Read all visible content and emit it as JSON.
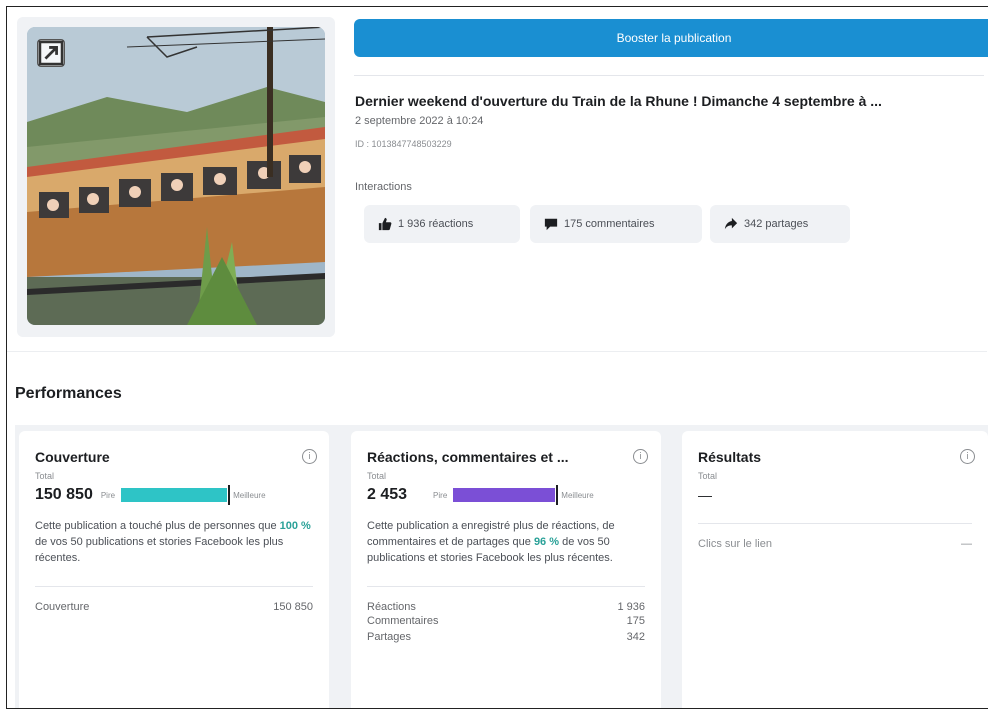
{
  "post": {
    "boost_label": "Booster la publication",
    "title": "Dernier weekend d'ouverture du Train de la Rhune ! Dimanche 4 septembre à ...",
    "date": "2 septembre 2022 à 10:24",
    "id_text": "ID : 1013847748503229",
    "interactions_label": "Interactions",
    "chips": [
      {
        "icon": "thumbs-up-icon",
        "label": "1 936 réactions"
      },
      {
        "icon": "comment-icon",
        "label": "175 commentaires"
      },
      {
        "icon": "share-icon",
        "label": "342 partages"
      }
    ]
  },
  "performances": {
    "title": "Performances",
    "coverage": {
      "title": "Couverture",
      "total_label": "Total",
      "value": "150 850",
      "low_label": "Pire",
      "high_label": "Meilleure",
      "bar_color": "#2ec4c6",
      "bar_fraction": 1.0,
      "desc_before": "Cette publication a touché plus de personnes que ",
      "desc_pct": "100 %",
      "desc_after": " de vos 50 publications et stories Facebook les plus récentes.",
      "row_label": "Couverture",
      "row_value": "150 850"
    },
    "engagement": {
      "title": "Réactions, commentaires et ...",
      "total_label": "Total",
      "value": "2 453",
      "low_label": "Pire",
      "high_label": "Meilleure",
      "bar_color": "#7b4fd6",
      "bar_fraction": 0.96,
      "desc_before": "Cette publication a enregistré plus de réactions, de commentaires et de partages que ",
      "desc_pct": "96 %",
      "desc_after": " de vos 50 publications et stories Facebook les plus récentes.",
      "rows": [
        {
          "label": "Réactions",
          "value": "1 936"
        },
        {
          "label": "Commentaires",
          "value": "175"
        },
        {
          "label": "Partages",
          "value": "342"
        }
      ]
    },
    "results": {
      "title": "Résultats",
      "total_label": "Total",
      "value": "—",
      "row_label": "Clics sur le lien",
      "row_value": "—"
    }
  },
  "info_symbol": "i"
}
